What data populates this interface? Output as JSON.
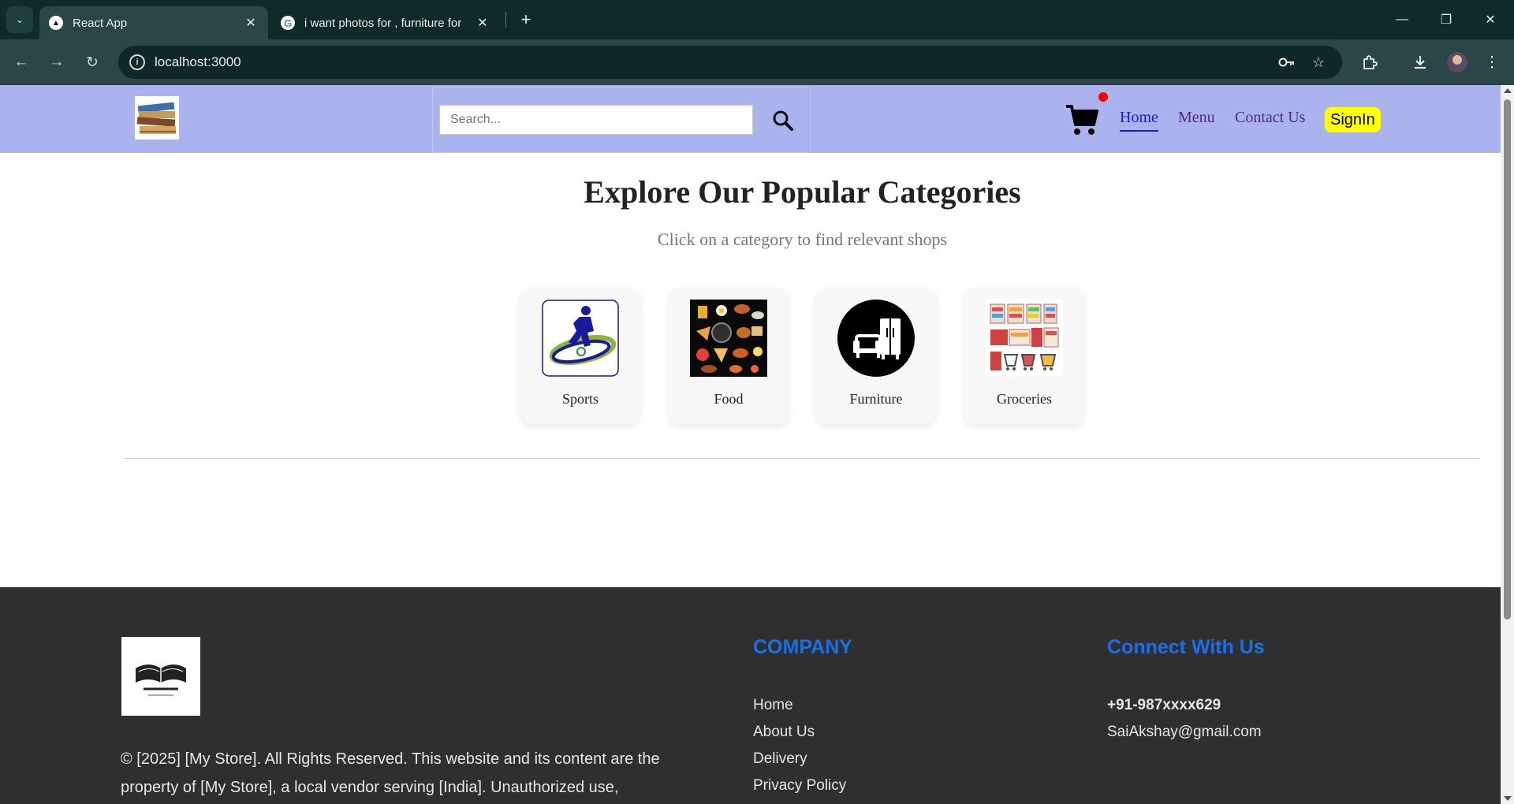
{
  "browser": {
    "tabs": [
      {
        "title": "React App",
        "active": true
      },
      {
        "title": "i want photos for , furniture for",
        "active": false
      }
    ],
    "url": "localhost:3000"
  },
  "header": {
    "search_placeholder": "Search...",
    "nav": {
      "home": "Home",
      "menu": "Menu",
      "contact": "Contact Us"
    },
    "signin": "SignIn"
  },
  "categories_section": {
    "title": "Explore Our Popular Categories",
    "subtitle": "Click on a category to find relevant shops",
    "items": [
      {
        "label": "Sports"
      },
      {
        "label": "Food"
      },
      {
        "label": "Furniture"
      },
      {
        "label": "Groceries"
      }
    ]
  },
  "footer": {
    "copyright": "© [2025] [My Store]. All Rights Reserved. This website and its content are the property of [My Store], a local vendor serving [India]. Unauthorized use,",
    "company": {
      "heading": "COMPANY",
      "links": [
        "Home",
        "About Us",
        "Delivery",
        "Privacy Policy"
      ]
    },
    "connect": {
      "heading": "Connect With Us",
      "phone": "+91-987xxxx629",
      "email": "SaiAkshay@gmail.com"
    }
  },
  "colors": {
    "header_bg": "#aab3ee",
    "signin_bg": "#ffff00",
    "footer_bg": "#2f2f2f",
    "footer_heading": "#1a6fe8",
    "nav_active": "#1a1ad0"
  }
}
